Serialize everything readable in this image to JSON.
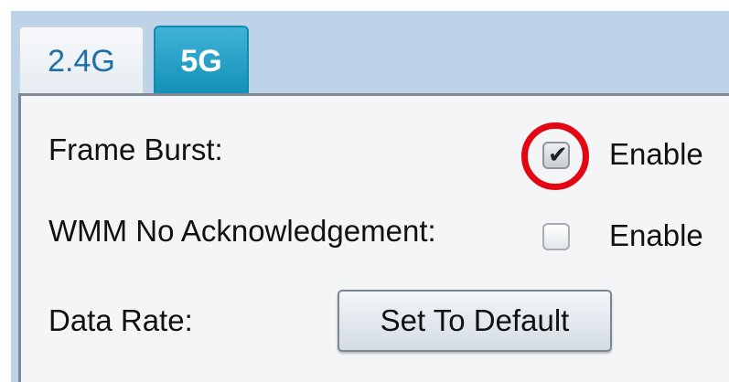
{
  "tabs": [
    {
      "label": "2.4G",
      "active": false
    },
    {
      "label": "5G",
      "active": true
    }
  ],
  "settings": {
    "frame_burst": {
      "label": "Frame Burst:",
      "checked": true,
      "checkbox_label": "Enable"
    },
    "wmm_no_ack": {
      "label": "WMM No Acknowledgement:",
      "checked": false,
      "checkbox_label": "Enable"
    },
    "data_rate": {
      "label": "Data Rate:",
      "button_label": "Set To Default"
    }
  },
  "colors": {
    "active_tab": "#1590b8",
    "highlight_ring": "#e30613",
    "frame_background": "#bdd3e7"
  },
  "icons": {
    "checkmark": "✔"
  }
}
